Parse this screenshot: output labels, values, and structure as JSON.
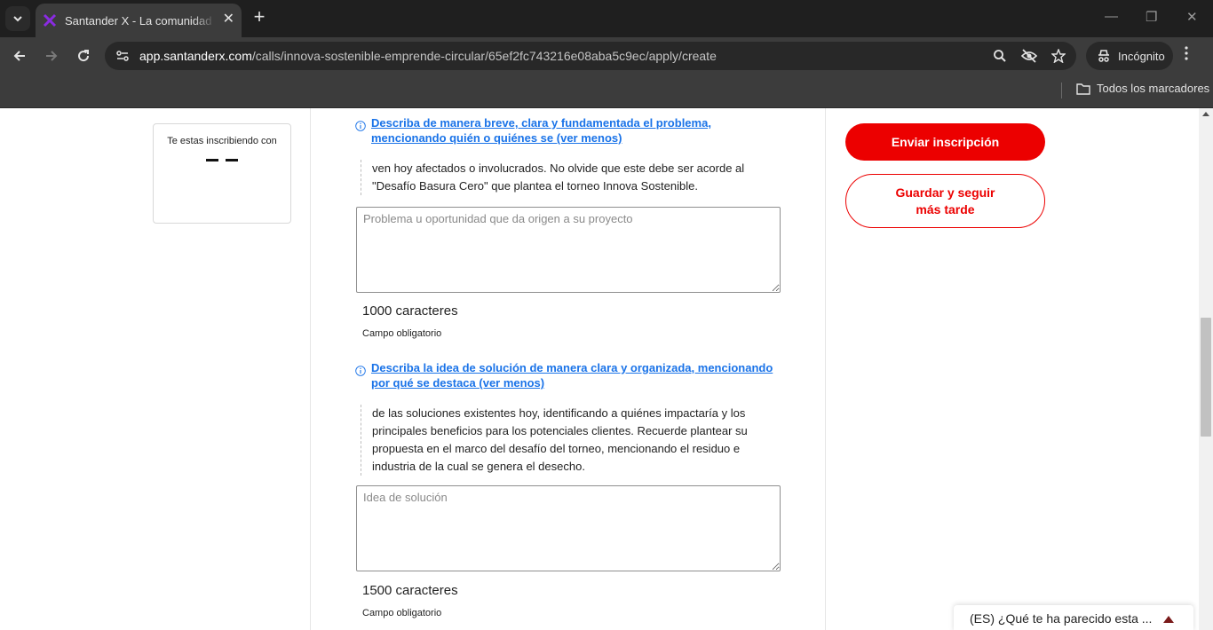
{
  "browser": {
    "tab_title": "Santander X - La comunidad global",
    "url_host": "app.santanderx.com",
    "url_path": "/calls/innova-sostenible-emprende-circular/65ef2fc743216e08aba5c9ec/apply/create",
    "incognito_label": "Incógnito",
    "bookmarks_label": "Todos los marcadores"
  },
  "sidebar": {
    "enroll_label": "Te estas inscribiendo con"
  },
  "form": {
    "problem": {
      "hint_link": "Describa de manera breve, clara y fundamentada el problema, mencionando quién o quiénes se (ver menos)",
      "hint_detail": "ven hoy afectados o involucrados. No olvide que este debe ser acorde al \"Desafío Basura Cero\" que plantea el torneo Innova Sostenible.",
      "placeholder": "Problema u oportunidad que da origen a su proyecto",
      "char_count": "1000 caracteres",
      "required": "Campo obligatorio"
    },
    "solution": {
      "hint_link": "Describa la idea de solución de manera clara y organizada, mencionando por qué se destaca (ver menos)",
      "hint_detail": "de las soluciones existentes hoy, identificando a quiénes impactaría y los principales beneficios para los potenciales clientes. Recuerde plantear su propuesta en el marco del desafío del torneo, mencionando el residuo e industria de la cual se genera el desecho.",
      "placeholder": "Idea de solución",
      "char_count": "1500 caracteres",
      "required": "Campo obligatorio"
    }
  },
  "actions": {
    "submit_label": "Enviar inscripción",
    "save_label": "Guardar y seguir más tarde"
  },
  "feedback": {
    "label": "(ES) ¿Qué te ha parecido esta ..."
  },
  "colors": {
    "brand_red": "#ec0000",
    "link_blue": "#1a73e8"
  }
}
